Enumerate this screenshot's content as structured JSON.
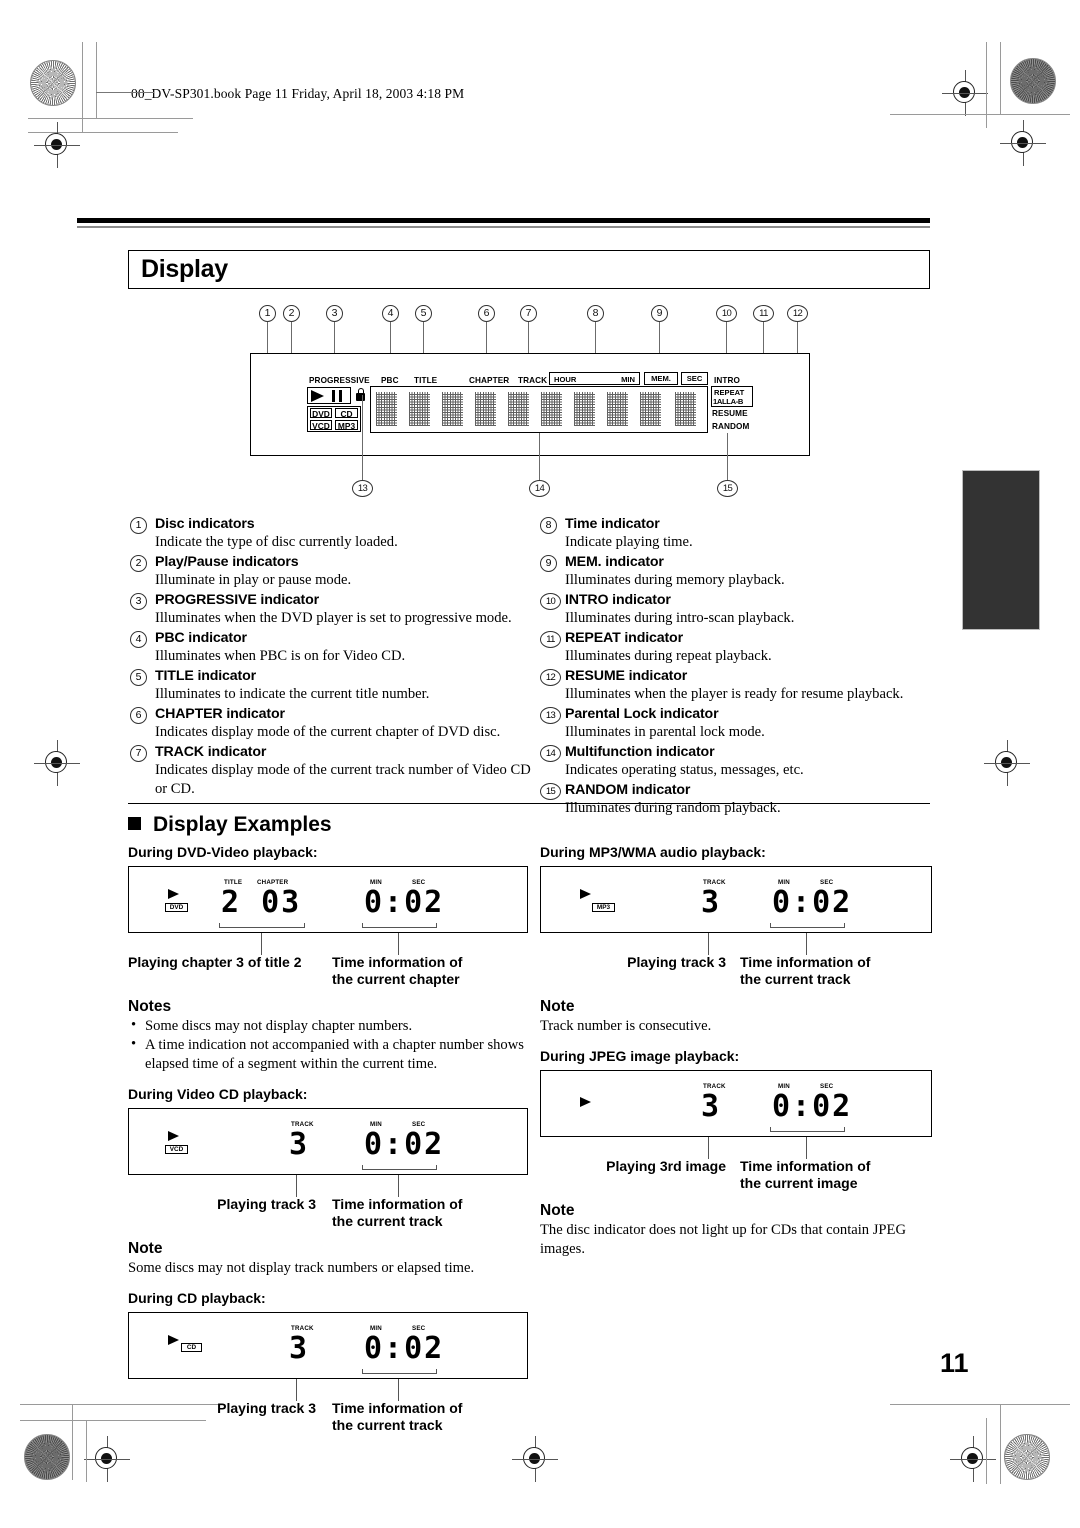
{
  "running_head": "00_DV-SP301.book  Page 11  Friday, April 18, 2003  4:18 PM",
  "page_number": "11",
  "section": {
    "title": "Display",
    "examples_heading": "Display Examples"
  },
  "display_panel": {
    "callout_numbers_top": [
      "1",
      "2",
      "3",
      "4",
      "5",
      "6",
      "7",
      "8",
      "9",
      "10",
      "11",
      "12"
    ],
    "callout_numbers_bottom": [
      "13",
      "14",
      "15"
    ],
    "labels": {
      "progressive": "PROGRESSIVE",
      "pbc": "PBC",
      "title": "TITLE",
      "chapter": "CHAPTER",
      "track": "TRACK",
      "hour": "HOUR",
      "min": "MIN",
      "mem": "MEM.",
      "sec": "SEC",
      "intro": "INTRO",
      "repeat": "REPEAT",
      "repeat_modes": "1ALLA-B",
      "resume": "RESUME",
      "random": "RANDOM"
    },
    "disc_boxes": [
      "DVD",
      "CD",
      "VCD",
      "MP3"
    ],
    "icons": [
      "play-icon",
      "pause-icon",
      "parental-lock-icon"
    ]
  },
  "indicators": {
    "left": [
      {
        "num": "1",
        "head": "Disc indicators",
        "body": "Indicate the type of disc currently loaded."
      },
      {
        "num": "2",
        "head": "Play/Pause indicators",
        "body": "Illuminate in play or pause mode."
      },
      {
        "num": "3",
        "head": "PROGRESSIVE indicator",
        "body": "Illuminates when the DVD player is set to progressive mode."
      },
      {
        "num": "4",
        "head": "PBC indicator",
        "body": "Illuminates when PBC is on for Video CD."
      },
      {
        "num": "5",
        "head": "TITLE indicator",
        "body": "Illuminates to indicate the current title number."
      },
      {
        "num": "6",
        "head": "CHAPTER indicator",
        "body": "Indicates display mode of the current chapter of DVD disc."
      },
      {
        "num": "7",
        "head": "TRACK indicator",
        "body": "Indicates display mode of the current track number of Video CD or CD."
      }
    ],
    "right": [
      {
        "num": "8",
        "head": "Time indicator",
        "body": "Indicate playing time."
      },
      {
        "num": "9",
        "head": "MEM. indicator",
        "body": "Illuminates during memory playback."
      },
      {
        "num": "10",
        "head": "INTRO indicator",
        "body": "Illuminates during intro-scan playback."
      },
      {
        "num": "11",
        "head": "REPEAT indicator",
        "body": "Illuminates during repeat playback."
      },
      {
        "num": "12",
        "head": "RESUME indicator",
        "body": "Illuminates when the player is ready for resume playback."
      },
      {
        "num": "13",
        "head": "Parental Lock indicator",
        "body": "Illuminates in parental lock mode."
      },
      {
        "num": "14",
        "head": "Multifunction indicator",
        "body": "Indicates operating status, messages, etc."
      },
      {
        "num": "15",
        "head": "RANDOM indicator",
        "body": "Illuminates during random playback."
      }
    ]
  },
  "examples": {
    "dvd": {
      "caption": "During DVD-Video playback:",
      "disc_badge": "DVD",
      "lab_title": "TITLE",
      "lab_chapter": "CHAPTER",
      "lab_min": "MIN",
      "lab_sec": "SEC",
      "digits_left": "2  03",
      "digits_right": "0:02",
      "note_left": "Playing chapter 3 of title 2",
      "note_right_l1": "Time information of",
      "note_right_l2": "the current chapter",
      "notes_head": "Notes",
      "note_1": "Some discs may not display chapter numbers.",
      "note_2": "A time indication not accompanied with a chapter number shows elapsed time of a segment within the current time."
    },
    "vcd": {
      "caption": "During Video CD playback:",
      "disc_badge": "VCD",
      "lab_track": "TRACK",
      "lab_min": "MIN",
      "lab_sec": "SEC",
      "digits_left": "3",
      "digits_right": "0:02",
      "note_left": "Playing track 3",
      "note_right_l1": "Time information of",
      "note_right_l2": "the current track",
      "notes_head": "Note",
      "note_1": "Some discs may not display track numbers or elapsed time."
    },
    "cd": {
      "caption": "During CD playback:",
      "disc_badge": "CD",
      "lab_track": "TRACK",
      "lab_min": "MIN",
      "lab_sec": "SEC",
      "digits_left": "3",
      "digits_right": "0:02",
      "note_left": "Playing track 3",
      "note_right_l1": "Time information of",
      "note_right_l2": "the current track"
    },
    "mp3": {
      "caption": "During MP3/WMA audio playback:",
      "disc_badge": "MP3",
      "lab_track": "TRACK",
      "lab_min": "MIN",
      "lab_sec": "SEC",
      "digits_left": "3",
      "digits_right": "0:02",
      "note_left": "Playing track 3",
      "note_right_l1": "Time information of",
      "note_right_l2": "the current track",
      "notes_head": "Note",
      "note_1": "Track number is consecutive."
    },
    "jpeg": {
      "caption": "During JPEG image playback:",
      "lab_track": "TRACK",
      "lab_min": "MIN",
      "lab_sec": "SEC",
      "digits_left": "3",
      "digits_right": "0:02",
      "note_left": "Playing 3rd image",
      "note_right_l1": "Time information of",
      "note_right_l2": "the current image",
      "notes_head": "Note",
      "note_1": "The disc indicator does not light up for CDs that contain JPEG images."
    }
  }
}
